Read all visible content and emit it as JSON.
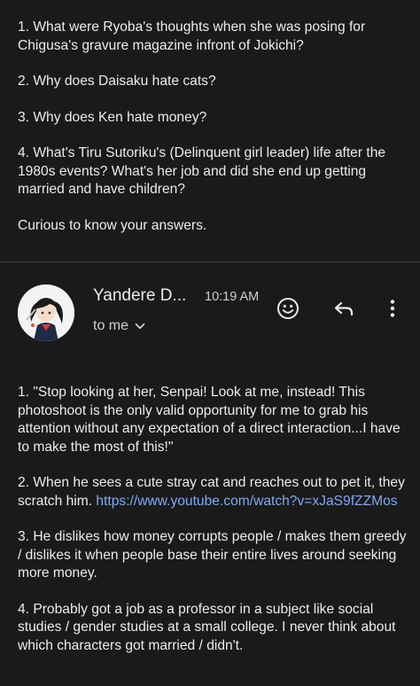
{
  "previous_message": {
    "paragraphs": [
      "1. What were Ryoba's thoughts when she was posing for Chigusa's gravure magazine infront of Jokichi?",
      "2. Why does Daisaku hate cats?",
      "3. Why does Ken hate money?",
      "4. What's Tiru Sutoriku's (Delinquent girl leader) life after the 1980s events? What's her job and did she end up getting married and have children?",
      "Curious to know your answers."
    ]
  },
  "reply_header": {
    "sender": "Yandere D...",
    "time": "10:19 AM",
    "recipient": "to me",
    "icons": {
      "emoji": "emoji-reaction-icon",
      "reply": "reply-arrow-icon",
      "more": "more-vertical-icon",
      "chevron": "chevron-down-icon"
    }
  },
  "reply_message": {
    "p1": "1. \"Stop looking at her, Senpai! Look at me, instead! This photoshoot is the only valid opportunity for me to grab his attention without any expectation of a direct interaction...I have to make the most of this!\"",
    "p2_text": "2. When he sees a cute stray cat and reaches out to pet it, they scratch him. ",
    "p2_link": "https://www.youtube.com/watch?v=xJaS9fZZMos",
    "p3": "3. He dislikes how money corrupts people / makes them greedy / dislikes it when people base their entire lives around seeking more money.",
    "p4": "4. Probably got a job as a professor in a subject like social studies / gender studies at a small college. I never think about which characters got married / didn't."
  },
  "colors": {
    "background": "#1a1a1a",
    "text": "#ececec",
    "link": "#7eaaf6"
  }
}
